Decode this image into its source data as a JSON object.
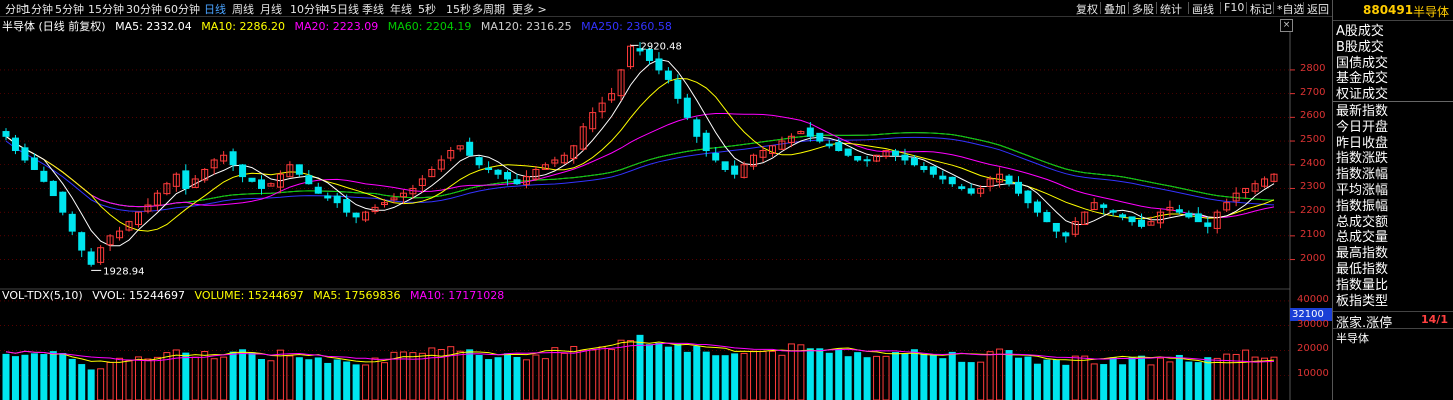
{
  "toolbar": {
    "periods": [
      "分时",
      "1分钟",
      "5分钟",
      "15分钟",
      "30分钟",
      "60分钟",
      "日线",
      "周线",
      "月线",
      "10分钟",
      "45日线",
      "季线",
      "年线",
      "5秒",
      "15秒",
      "多周期",
      "更多 >"
    ],
    "active_period": "日线",
    "tools": [
      "复权",
      "叠加",
      "多股",
      "统计",
      "画线",
      "F10",
      "标记",
      "*自选",
      "返回"
    ]
  },
  "legend": {
    "title": "半导体 (日线 前复权)",
    "ma5": "MA5: 2332.04",
    "ma10": "MA10: 2286.20",
    "ma20": "MA20: 2223.09",
    "ma60": "MA60: 2204.19",
    "ma120": "MA120: 2316.25",
    "ma250": "MA250: 2360.58"
  },
  "annotations": {
    "high": "2920.48",
    "low": "1928.94"
  },
  "vol_legend": {
    "title": "VOL-TDX(5,10)",
    "vvol": "VVOL: 15244697",
    "volume": "VOLUME: 15244697",
    "ma5": "MA5: 17569836",
    "ma10": "MA10: 17171028"
  },
  "current_vol_label": "32100",
  "close_button": "×",
  "colors": {
    "up": "#ff3b3b",
    "down": "#00e5ee",
    "ma5": "#ffffff",
    "ma10": "#ffff00",
    "ma20": "#ff00ff",
    "ma60": "#00cc00",
    "ma120": "#cccccc",
    "ma250": "#3333ff"
  },
  "right_panel": {
    "code": "880491",
    "name": "半导体",
    "menu_top": [
      "A股成交",
      "B股成交",
      "国债成交",
      "基金成交",
      "权证成交"
    ],
    "menu_bottom": [
      "最新指数",
      "今日开盘",
      "昨日收盘",
      "指数涨跌",
      "指数涨幅",
      "平均涨幅",
      "指数振幅",
      "总成交额",
      "总成交量",
      "最高指数",
      "最低指数",
      "指数量比",
      "板指类型"
    ],
    "zd_label": "涨家.涨停",
    "zd_value": "14/1",
    "sector": "半导体"
  },
  "chart_data": {
    "type": "candlestick",
    "price_axis": {
      "ticks": [
        2000,
        2100,
        2200,
        2300,
        2400,
        2500,
        2600,
        2700,
        2800
      ]
    },
    "volume_axis": {
      "ticks": [
        10000,
        20000,
        30000,
        40000
      ]
    },
    "closes": [
      2520,
      2460,
      2420,
      2380,
      2330,
      2270,
      2200,
      2120,
      2040,
      1980,
      2050,
      2100,
      2120,
      2160,
      2200,
      2230,
      2280,
      2320,
      2360,
      2300,
      2340,
      2380,
      2420,
      2440,
      2400,
      2350,
      2330,
      2300,
      2320,
      2360,
      2400,
      2360,
      2320,
      2280,
      2260,
      2240,
      2200,
      2180,
      2200,
      2220,
      2240,
      2260,
      2280,
      2300,
      2340,
      2380,
      2420,
      2460,
      2480,
      2440,
      2400,
      2380,
      2360,
      2340,
      2320,
      2350,
      2380,
      2400,
      2420,
      2440,
      2480,
      2560,
      2620,
      2660,
      2700,
      2800,
      2900,
      2880,
      2840,
      2800,
      2760,
      2680,
      2600,
      2520,
      2460,
      2420,
      2380,
      2360,
      2400,
      2440,
      2460,
      2480,
      2500,
      2520,
      2540,
      2520,
      2500,
      2480,
      2460,
      2440,
      2420,
      2420,
      2440,
      2460,
      2440,
      2420,
      2400,
      2380,
      2360,
      2340,
      2320,
      2300,
      2280,
      2300,
      2340,
      2360,
      2320,
      2280,
      2240,
      2200,
      2160,
      2120,
      2100,
      2160,
      2200,
      2240,
      2220,
      2200,
      2180,
      2160,
      2140,
      2160,
      2200,
      2220,
      2200,
      2180,
      2160,
      2140,
      2200,
      2240,
      2280,
      2300,
      2320,
      2340,
      2360
    ],
    "volume_points": 133,
    "high_mark": 2920.48,
    "low_mark": 1928.94
  }
}
